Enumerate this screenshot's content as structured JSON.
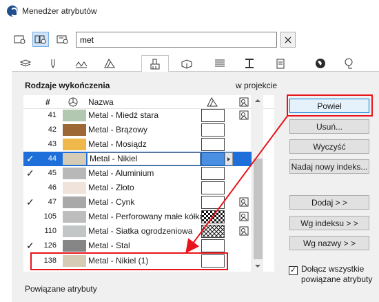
{
  "window": {
    "title": "Menedżer atrybutów"
  },
  "search": {
    "value": "met",
    "clear_icon": "close-icon"
  },
  "tabs": [
    {
      "icon": "layers-icon"
    },
    {
      "icon": "pen-icon"
    },
    {
      "icon": "line-type-icon"
    },
    {
      "icon": "fill-icon"
    },
    {
      "icon": "surface-brush-icon",
      "active": true
    },
    {
      "icon": "composite-icon"
    },
    {
      "icon": "profile-icon"
    },
    {
      "icon": "column-icon"
    },
    {
      "icon": "document-icon"
    },
    {
      "icon": "globe-icon"
    },
    {
      "icon": "reference-icon"
    }
  ],
  "panel": {
    "title": "Rodzaje wykończenia",
    "in_project_label": "w projekcie",
    "related_label": "Powiązane atrybuty"
  },
  "list": {
    "columns": {
      "number": "#",
      "name": "Nazwa"
    },
    "rows": [
      {
        "checked": false,
        "number": "41",
        "color": "#b3c8b0",
        "name": "Metal - Miedź stara",
        "hatch": "empty",
        "in_project_icon": true
      },
      {
        "checked": false,
        "number": "42",
        "color": "#9b6836",
        "name": "Metal - Brązowy",
        "hatch": "empty",
        "in_project_icon": false
      },
      {
        "checked": false,
        "number": "43",
        "color": "#f0b84a",
        "name": "Metal - Mosiądz",
        "hatch": "empty",
        "in_project_icon": false
      },
      {
        "checked": true,
        "number": "44",
        "color": "#d6cbb5",
        "name": "Metal - Nikiel",
        "hatch": "blue",
        "in_project_icon": false,
        "selected": true
      },
      {
        "checked": true,
        "number": "45",
        "color": "#b8b8b8",
        "name": "Metal - Aluminium",
        "hatch": "empty",
        "in_project_icon": false
      },
      {
        "checked": false,
        "number": "46",
        "color": "#f0e3dc",
        "name": "Metal - Złoto",
        "hatch": "empty",
        "in_project_icon": false
      },
      {
        "checked": true,
        "number": "47",
        "color": "#a9a9a9",
        "name": "Metal - Cynk",
        "hatch": "empty",
        "in_project_icon": true
      },
      {
        "checked": false,
        "number": "105",
        "color": "#bdbdbd",
        "name": "Metal - Perforowany małe kółka",
        "hatch": "checker",
        "in_project_icon": true
      },
      {
        "checked": false,
        "number": "110",
        "color": "#c2c6c6",
        "name": "Metal - Siatka ogrodzeniowa",
        "hatch": "diamond",
        "in_project_icon": true
      },
      {
        "checked": true,
        "number": "126",
        "color": "#868686",
        "name": "Metal - Stal",
        "hatch": "empty",
        "in_project_icon": false
      },
      {
        "checked": false,
        "number": "138",
        "color": "#d6cbb5",
        "name": "Metal - Nikiel (1)",
        "hatch": "empty",
        "in_project_icon": false,
        "highlighted": true
      }
    ]
  },
  "buttons": {
    "duplicate": "Powiel",
    "delete": "Usuń...",
    "clear": "Wyczyść",
    "new_index": "Nadaj nowy indeks...",
    "add": "Dodaj > >",
    "by_index": "Wg indeksu > >",
    "by_name": "Wg nazwy > >"
  },
  "include_related": {
    "checked": true,
    "label": "Dołącz wszystkie powiązane atrybuty"
  },
  "colors": {
    "selection": "#1e6fd9",
    "annotation": "#e8141b"
  }
}
